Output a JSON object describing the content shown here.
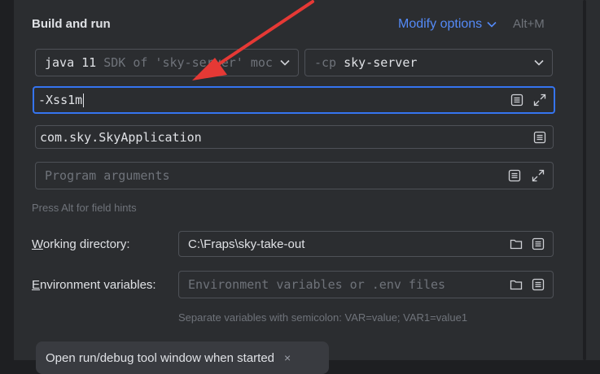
{
  "section": {
    "title": "Build and run"
  },
  "modify": {
    "label": "Modify options",
    "shortcut": "Alt+M"
  },
  "jdk_select": {
    "value_main": "java 11",
    "value_hint": "SDK of 'sky-server' moc"
  },
  "classpath_select": {
    "prefix": "-cp",
    "value": "sky-server"
  },
  "vm_options": {
    "value": "-Xss1m"
  },
  "main_class": {
    "value": "com.sky.SkyApplication"
  },
  "program_args": {
    "placeholder": "Program arguments"
  },
  "field_hint": "Press Alt for field hints",
  "working_dir": {
    "label_first": "W",
    "label_rest": "orking directory:",
    "value": "C:\\Fraps\\sky-take-out"
  },
  "env_vars": {
    "label_first": "E",
    "label_rest": "nvironment variables:",
    "placeholder": "Environment variables or .env files",
    "hint": "Separate variables with semicolon: VAR=value; VAR1=value1"
  },
  "chip": {
    "label": "Open run/debug tool window when started",
    "close": "×"
  },
  "colors": {
    "accent": "#548af7",
    "focus": "#3574f0",
    "annotation_arrow": "#e53935"
  },
  "icons": [
    "chevron-down-icon",
    "notes-icon",
    "expand-icon",
    "folder-icon",
    "close-icon"
  ]
}
